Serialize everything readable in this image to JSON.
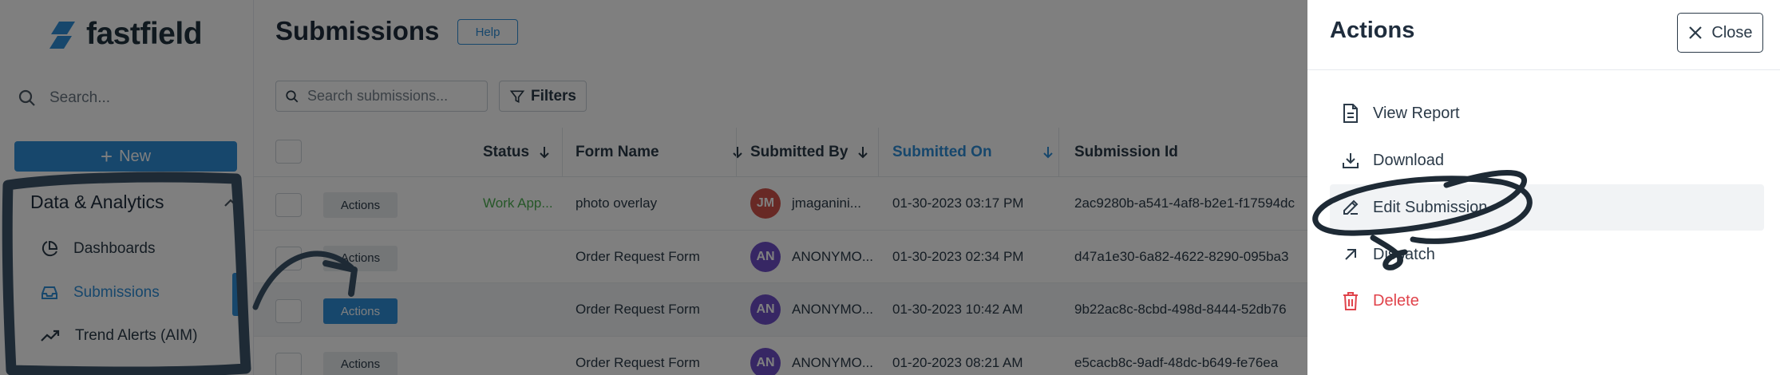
{
  "brand": {
    "name": "fastfield",
    "color": "#2f8fd8"
  },
  "sidebar": {
    "search_placeholder": "Search...",
    "new_button": "New",
    "section_title": "Data & Analytics",
    "items": [
      {
        "label": "Dashboards",
        "icon": "pie-chart-icon"
      },
      {
        "label": "Submissions",
        "icon": "inbox-icon",
        "active": true
      },
      {
        "label": "Trend Alerts (AIM)",
        "icon": "trending-up-icon"
      }
    ]
  },
  "main": {
    "title": "Submissions",
    "help_label": "Help",
    "search_placeholder": "Search submissions...",
    "filters_label": "Filters",
    "columns": {
      "status": "Status",
      "form_name": "Form Name",
      "submitted_by": "Submitted By",
      "submitted_on": "Submitted On",
      "submission_id": "Submission Id"
    },
    "rows": [
      {
        "action": "Actions",
        "status": "Work App...",
        "form": "photo overlay",
        "initials": "JM",
        "avatar_color": "#d0524a",
        "user": "jmaganini...",
        "date": "01-30-2023 03:17 PM",
        "id": "2ac9280b-a541-4af8-b2e1-f17594dc"
      },
      {
        "action": "Actions",
        "status": "",
        "form": "Order Request Form",
        "initials": "AN",
        "avatar_color": "#6f4fc9",
        "user": "ANONYMO...",
        "date": "01-30-2023 02:34 PM",
        "id": "d47a1e30-6a82-4622-8290-095ba3"
      },
      {
        "action": "Actions",
        "status": "",
        "form": "Order Request Form",
        "initials": "AN",
        "avatar_color": "#6f4fc9",
        "user": "ANONYMO...",
        "date": "01-30-2023 10:42 AM",
        "id": "9b22ac8c-8cbd-498d-8444-52db76"
      },
      {
        "action": "Actions",
        "status": "",
        "form": "Order Request Form",
        "initials": "AN",
        "avatar_color": "#6f4fc9",
        "user": "ANONYMO...",
        "date": "01-20-2023 08:21 AM",
        "id": "e5cacb8c-9adf-48dc-b649-fe76ea"
      }
    ]
  },
  "panel": {
    "title": "Actions",
    "close_label": "Close",
    "items": [
      {
        "label": "View Report",
        "icon": "file-text-icon"
      },
      {
        "label": "Download",
        "icon": "download-icon"
      },
      {
        "label": "Edit Submission",
        "icon": "pencil-icon"
      },
      {
        "label": "Dispatch",
        "icon": "arrow-up-right-icon"
      },
      {
        "label": "Delete",
        "icon": "trash-icon"
      }
    ]
  }
}
